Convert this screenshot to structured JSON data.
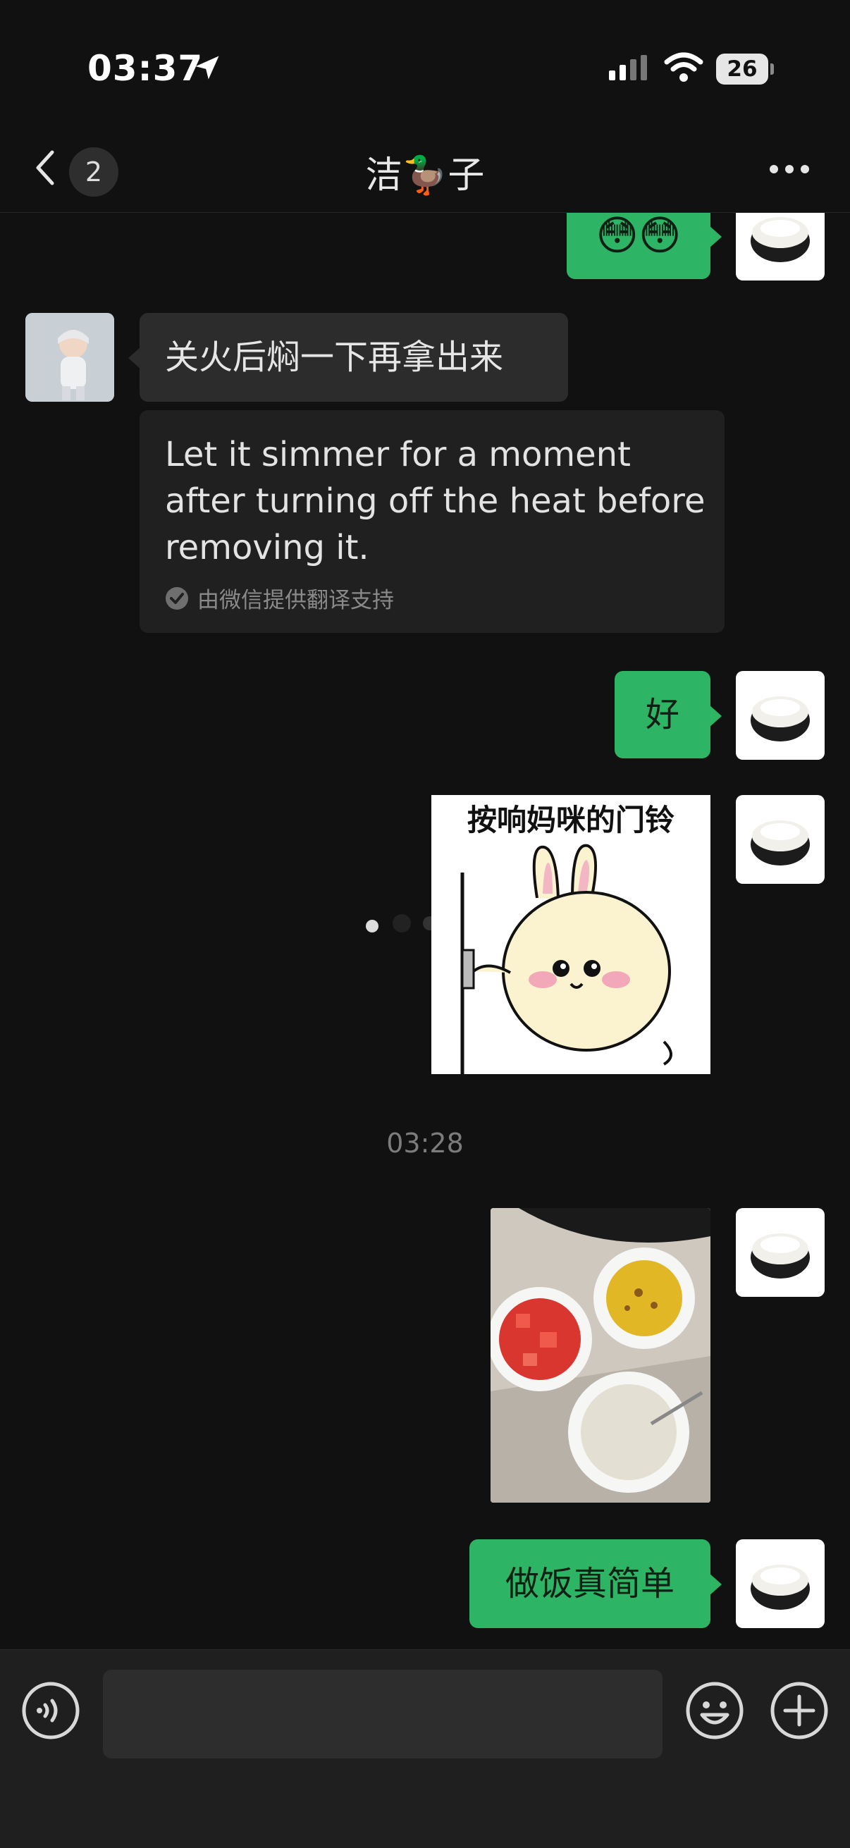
{
  "status_bar": {
    "time": "03:37",
    "battery": "26",
    "icons": [
      "location-arrow-icon",
      "signal-icon",
      "wifi-icon",
      "battery-icon"
    ]
  },
  "nav": {
    "title": "洁🦆子",
    "unread_count": "2",
    "icons": [
      "back-chevron-icon",
      "more-icon"
    ]
  },
  "messages": [
    {
      "id": "m1",
      "sender": "me",
      "type": "text",
      "text": "😳😳"
    },
    {
      "id": "m2",
      "sender": "other",
      "type": "text",
      "text": "关火后焖一下再拿出来",
      "translation": {
        "text": "Let it simmer for a moment after turning off the heat before removing it.",
        "note": "由微信提供翻译支持"
      }
    },
    {
      "id": "m3",
      "sender": "me",
      "type": "text",
      "text": "好"
    },
    {
      "id": "m4",
      "sender": "me",
      "type": "sticker",
      "caption": "按响妈咪的门铃"
    },
    {
      "id": "m5",
      "sender": "me",
      "type": "photo",
      "description": "food-photo"
    },
    {
      "id": "m6",
      "sender": "me",
      "type": "text",
      "text": "做饭真简单"
    }
  ],
  "timestamp": "03:28",
  "input_bar": {
    "placeholder": "",
    "icons": [
      "voice-icon",
      "emoji-icon",
      "plus-icon"
    ]
  },
  "colors": {
    "background": "#111111",
    "bubble_me": "#2db565",
    "bubble_other": "#2c2c2c",
    "input_bar": "#1f1f1f"
  }
}
